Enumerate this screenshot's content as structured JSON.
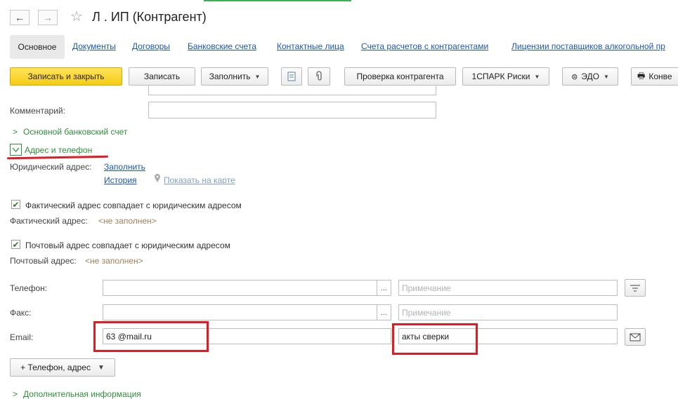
{
  "header": {
    "title": "Л                   . ИП (Контрагент)",
    "back": "←",
    "forward": "→",
    "star": "☆"
  },
  "tabs": [
    {
      "label": "Основное",
      "active": true
    },
    {
      "label": "Документы"
    },
    {
      "label": "Договоры"
    },
    {
      "label": "Банковские счета"
    },
    {
      "label": "Контактные лица"
    },
    {
      "label": "Счета расчетов с контрагентами"
    },
    {
      "label": "Лицензии поставщиков алкогольной пр"
    }
  ],
  "toolbar": {
    "save_close": "Записать и закрыть",
    "save": "Записать",
    "fill": "Заполнить",
    "check": "Проверка контрагента",
    "spark": "1СПАРК Риски",
    "edo": "ЭДО",
    "convert": "Конве"
  },
  "form": {
    "comment_label": "Комментарий:",
    "bank_section": "Основной банковский счет",
    "address_section": "Адрес и телефон",
    "legal_address_label": "Юридический адрес:",
    "fill_link": "Заполнить",
    "history_link": "История",
    "map_link": "Показать на карте",
    "actual_same": "Фактический адрес совпадает с юридическим адресом",
    "actual_label": "Фактический адрес:",
    "actual_value": "<не заполнен>",
    "postal_same": "Почтовый адрес совпадает с юридическим адресом",
    "postal_label": "Почтовый адрес:",
    "postal_value": "<не заполнен>",
    "phone_label": "Телефон:",
    "fax_label": "Факс:",
    "email_label": "Email:",
    "email_value": "63          @mail.ru",
    "note_placeholder": "Примечание",
    "email_note": "акты сверки",
    "dots": "...",
    "add_phone": "+ Телефон, адрес",
    "more_section": "Дополнительная информация"
  },
  "colors": {
    "accent_yellow": "#f5cc13",
    "green": "#2f8e3a",
    "link_blue": "#1d57b1",
    "highlight_red": "#e01b24"
  }
}
